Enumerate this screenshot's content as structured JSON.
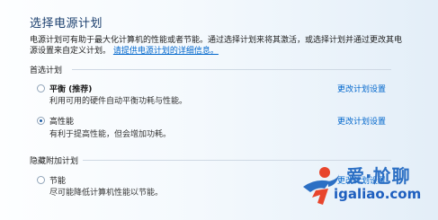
{
  "page_title": "选择电源计划",
  "description": {
    "text": "电源计划可有助于最大化计算机的性能或者节能。通过选择计划来将其激活，或选择计划并通过更改其电源设置来自定义计划。",
    "link": "请提供电源计划的详细信息。"
  },
  "sections": {
    "preferred_label": "首选计划",
    "hidden_label": "隐藏附加计划"
  },
  "plans": [
    {
      "name": "平衡 (推荐)",
      "desc": "利用可用的硬件自动平衡功耗与性能。",
      "change": "更改计划设置",
      "selected": false
    },
    {
      "name": "高性能",
      "desc": "有利于提高性能，但会增加功耗。",
      "change": "更改计划设置",
      "selected": true
    },
    {
      "name": "节能",
      "desc": "尽可能降低计算机性能以节能。",
      "change": "更改计划设置",
      "selected": false
    }
  ],
  "watermark": {
    "top": "爱·尬聊",
    "bottom": "igaliao.com"
  },
  "colors": {
    "title": "#1b3f6e",
    "link": "#0066cc",
    "watermark": "#2b6fc4",
    "watermark_accent": "#e8452c"
  }
}
